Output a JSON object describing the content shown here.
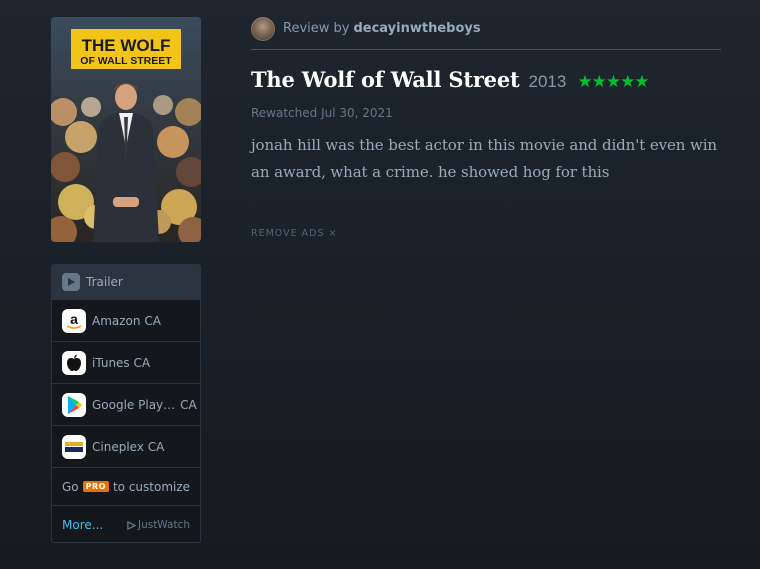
{
  "poster": {
    "headline_line1": "THE WOLF",
    "headline_line2": "OF WALL STREET"
  },
  "review": {
    "review_by_label": "Review by",
    "username": "decayinwtheboys",
    "film_title": "The Wolf of Wall Street",
    "year": "2013",
    "rating_stars": "★★★★★",
    "rating": 5,
    "watched_label": "Rewatched Jul 30, 2021",
    "text": "jonah hill was the best actor in this movie and didn't even win an award, what a crime. he showed hog for this",
    "remove_ads": "REMOVE ADS ×"
  },
  "services": {
    "trailer_label": "Trailer",
    "items": [
      {
        "label": "Amazon CA",
        "icon": "amazon-icon"
      },
      {
        "label": "iTunes CA",
        "icon": "apple-icon"
      },
      {
        "label": "Google Play…",
        "region": "CA",
        "icon": "google-play-icon"
      },
      {
        "label": "Cineplex CA",
        "icon": "cineplex-icon"
      }
    ],
    "pro_prefix": "Go",
    "pro_badge": "PRO",
    "pro_suffix": "to customize",
    "more_label": "More...",
    "justwatch_label": "JustWatch"
  },
  "colors": {
    "background": "#1e252d",
    "star_green": "#00c030",
    "pro_orange": "#ee7000",
    "link_blue": "#40bcf4"
  }
}
